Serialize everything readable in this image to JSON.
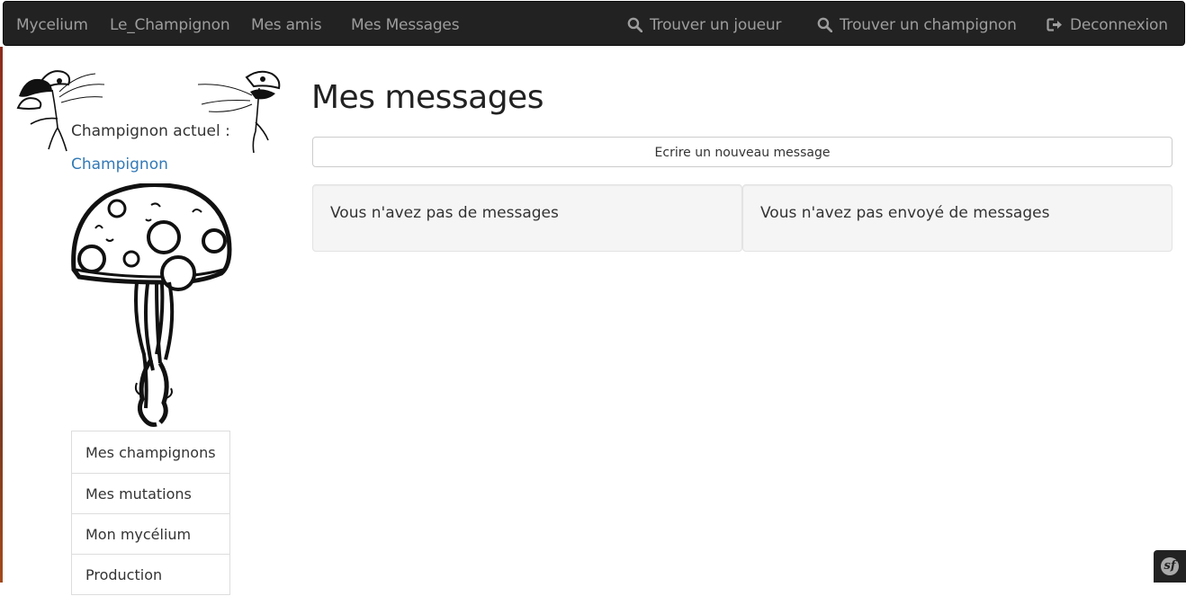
{
  "navbar": {
    "brand": "Mycelium",
    "links": [
      "Le_Champignon",
      "Mes amis",
      "Mes Messages"
    ],
    "find_player": "Trouver un joueur",
    "find_mushroom": "Trouver un champignon",
    "logout": "Deconnexion"
  },
  "sidebar": {
    "current_label": "Champignon actuel :",
    "current_name": "Champignon",
    "menu": [
      "Mes champignons",
      "Mes mutations",
      "Mon mycélium",
      "Production"
    ]
  },
  "main": {
    "title": "Mes messages",
    "new_message_button": "Ecrire un nouveau message",
    "received_empty": "Vous n'avez pas de messages",
    "sent_empty": "Vous n'avez pas envoyé de messages"
  },
  "colors": {
    "navbar_bg": "#222222",
    "nav_text": "#9d9d9d",
    "link": "#337ab7",
    "well_bg": "#f5f5f5"
  },
  "icons": {
    "find_player": "search-icon",
    "find_mushroom": "search-icon",
    "logout": "logout-icon",
    "debug_toolbar": "symfony-logo-icon"
  }
}
